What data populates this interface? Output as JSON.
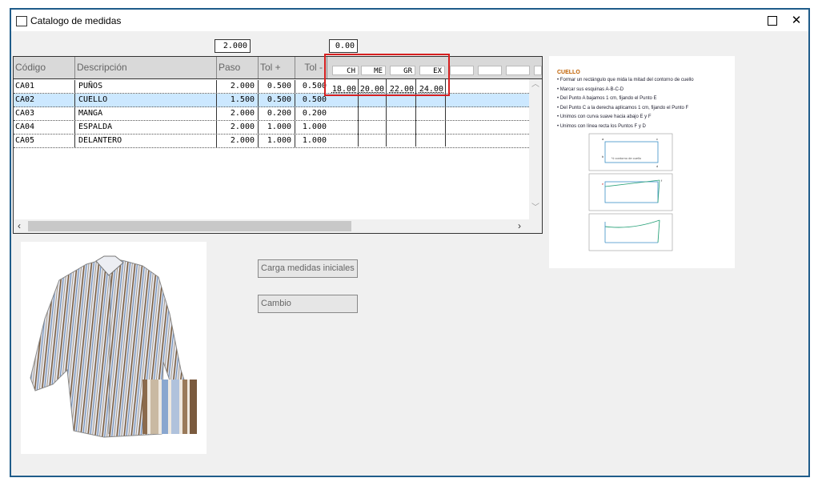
{
  "window": {
    "title": "Catalogo de medidas",
    "close_glyph": "✕"
  },
  "inputs": {
    "paso_value": "2.000",
    "size_value": "0.00"
  },
  "grid": {
    "headers": {
      "codigo": "Código",
      "descripcion": "Descripción",
      "paso": "Paso",
      "tol_plus": "Tol +",
      "tol_minus": "Tol -"
    },
    "size_columns": [
      "CH",
      "ME",
      "GR",
      "EX"
    ],
    "rows": [
      {
        "codigo": "CA01",
        "descripcion": "PUÑOS",
        "paso": "2.000",
        "tol_plus": "0.500",
        "tol_minus": "0.500"
      },
      {
        "codigo": "CA02",
        "descripcion": "CUELLO",
        "paso": "1.500",
        "tol_plus": "0.500",
        "tol_minus": "0.500"
      },
      {
        "codigo": "CA03",
        "descripcion": "MANGA",
        "paso": "2.000",
        "tol_plus": "0.200",
        "tol_minus": "0.200"
      },
      {
        "codigo": "CA04",
        "descripcion": "ESPALDA",
        "paso": "2.000",
        "tol_plus": "1.000",
        "tol_minus": "1.000"
      },
      {
        "codigo": "CA05",
        "descripcion": "DELANTERO",
        "paso": "2.000",
        "tol_plus": "1.000",
        "tol_minus": "1.000"
      }
    ],
    "size_values": [
      "18.00",
      "20.00",
      "22.00",
      "24.00"
    ],
    "selected_row": "CA02"
  },
  "buttons": {
    "load_initial": "Carga medidas iniciales",
    "change": "Cambio"
  },
  "info": {
    "title": "CUELLO",
    "steps": [
      "Formar un rectángulo que mida la mitad del contorno de cuello",
      "Marcar sus esquinas A-B-C-D",
      "Del Punto A bajamos 1 cm, fijando el Punto E",
      "Del Punto C a la derecha aplicamos 1 cm, fijando el Punto F",
      "Unimos con curva suave hacia abajo E y F",
      "Unimos con línea recta los Puntos F y D"
    ],
    "diagram_label": "½ contorno de cuello",
    "points": {
      "a": "a",
      "b": "b",
      "c": "c",
      "d": "d",
      "e": "e",
      "f": "f"
    }
  },
  "colors": {
    "accent_border": "#1f5c8a",
    "highlight": "#d62020",
    "selected_row": "#cce8ff"
  }
}
